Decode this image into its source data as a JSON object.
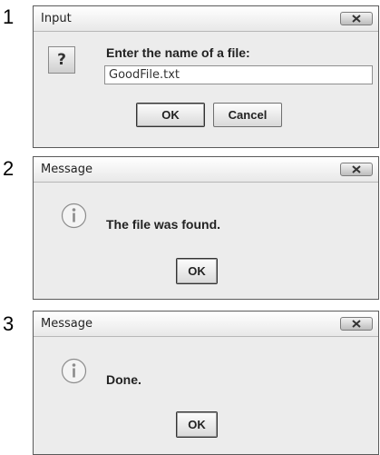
{
  "steps": [
    "1",
    "2",
    "3"
  ],
  "dialog_input": {
    "title": "Input",
    "icon": "question-icon",
    "icon_glyph": "?",
    "prompt": "Enter the name of a file:",
    "field_value": "GoodFile.txt",
    "ok_label": "OK",
    "cancel_label": "Cancel"
  },
  "dialog_found": {
    "title": "Message",
    "icon": "info-icon",
    "message": "The file was found.",
    "ok_label": "OK"
  },
  "dialog_done": {
    "title": "Message",
    "icon": "info-icon",
    "message": "Done.",
    "ok_label": "OK"
  }
}
